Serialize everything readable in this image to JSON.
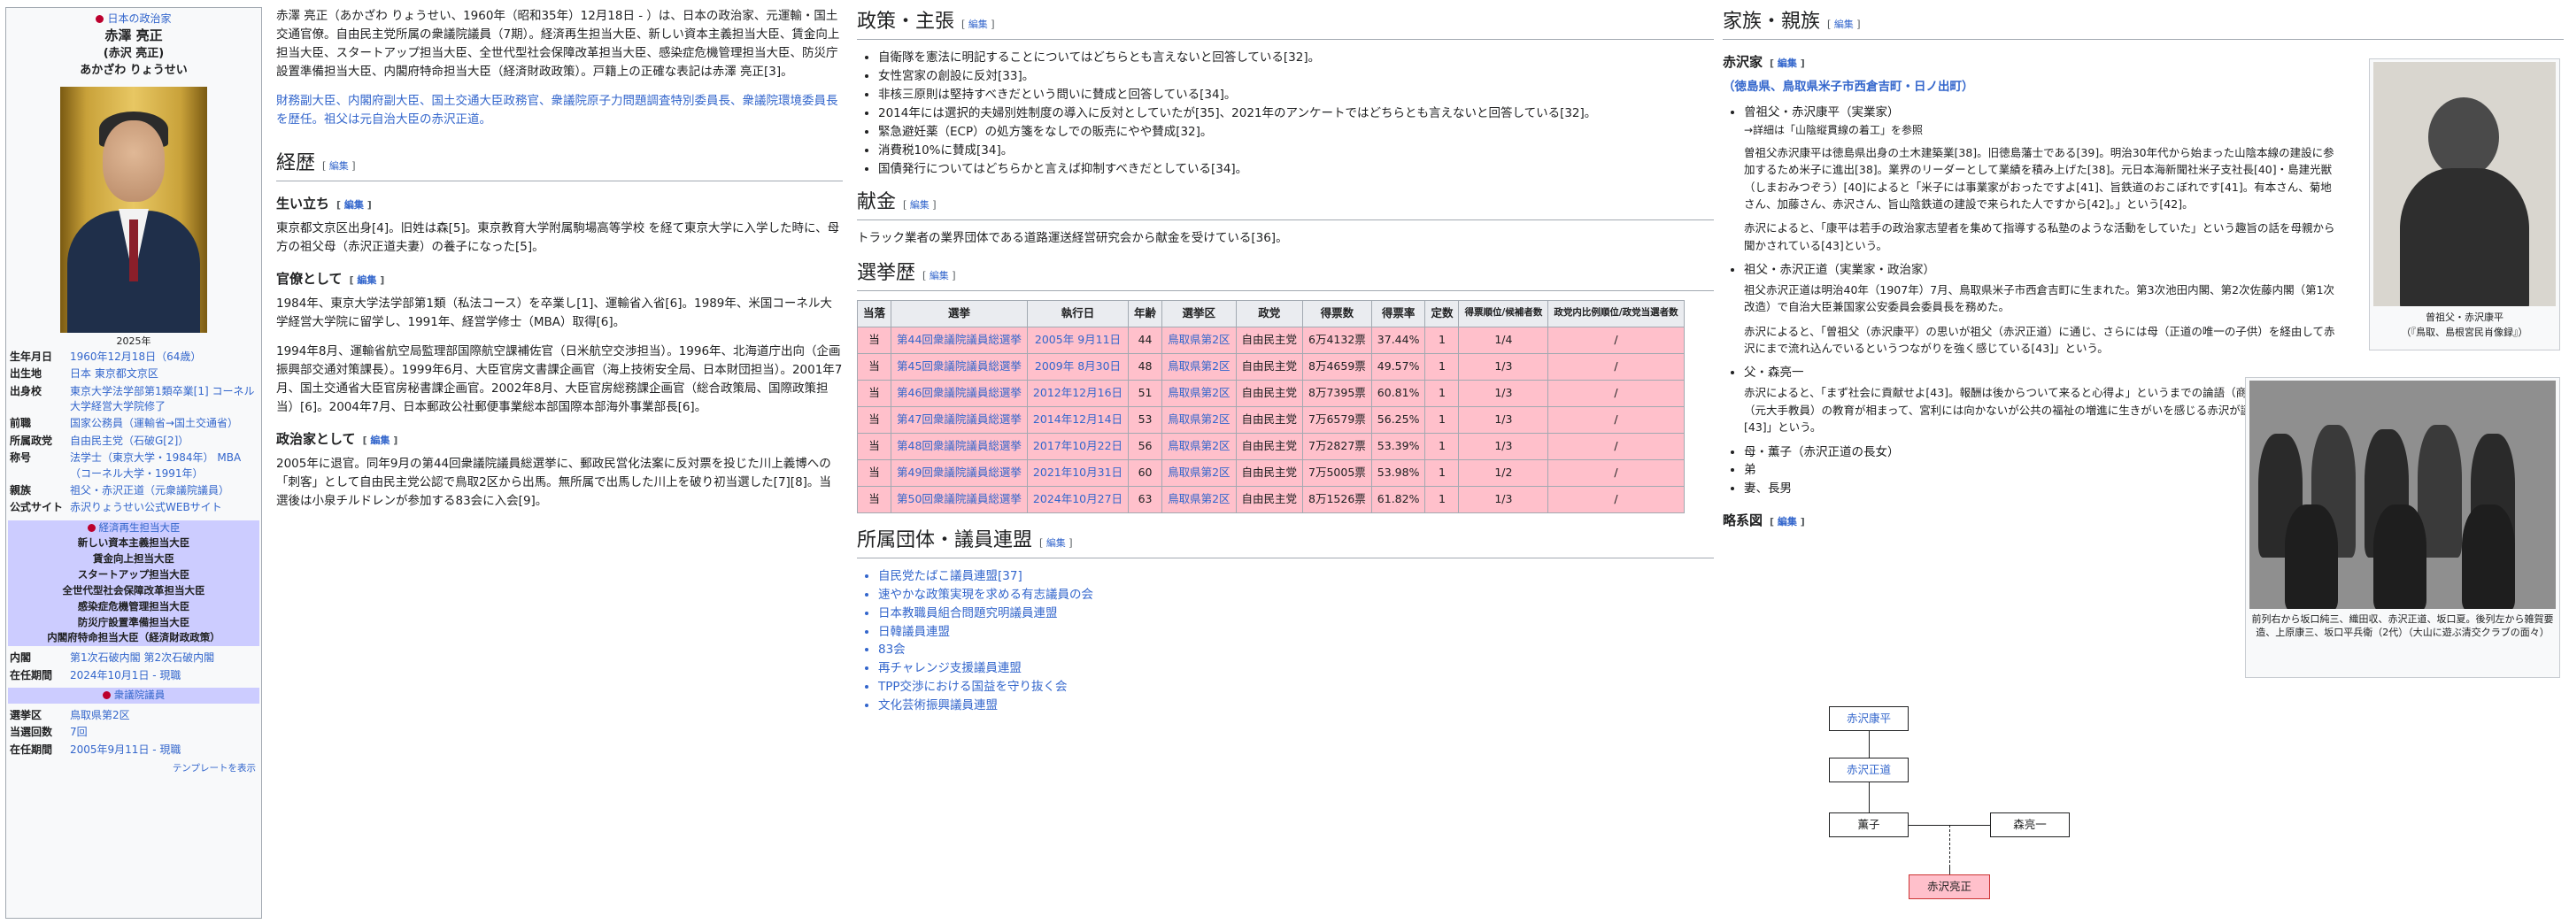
{
  "infobox": {
    "top_label": "日本の政治家",
    "name": "赤澤 亮正",
    "name_old": "(赤沢 亮正)",
    "reading": "あかざわ りょうせい",
    "photo_caption": "2025年",
    "rows": [
      {
        "k": "生年月日",
        "v": "1960年12月18日（64歳）"
      },
      {
        "k": "出生地",
        "v": "日本 東京都文京区"
      },
      {
        "k": "出身校",
        "v": "東京大学法学部第1類卒業[1] コーネル大学経営大学院修了"
      },
      {
        "k": "前職",
        "v": "国家公務員（運輸省→国土交通省）"
      },
      {
        "k": "所属政党",
        "v": "自由民主党（石破G[2]）"
      },
      {
        "k": "称号",
        "v": "法学士（東京大学・1984年） MBA（コーネル大学・1991年）"
      },
      {
        "k": "親族",
        "v": "祖父・赤沢正道（元衆議院議員）"
      },
      {
        "k": "公式サイト",
        "v": "赤沢りょうせい公式WEBサイト"
      }
    ],
    "band1_title": "経済再生担当大臣",
    "band1_lines": [
      "新しい資本主義担当大臣",
      "賃金向上担当大臣",
      "スタートアップ担当大臣",
      "全世代型社会保障改革担当大臣",
      "感染症危機管理担当大臣",
      "防災庁設置準備担当大臣",
      "内閣府特命担当大臣（経済財政政策）"
    ],
    "rows2": [
      {
        "k": "内閣",
        "v": "第1次石破内閣 第2次石破内閣"
      },
      {
        "k": "在任期間",
        "v": "2024年10月1日 - 現職"
      }
    ],
    "band2_title": "衆議院議員",
    "rows3": [
      {
        "k": "選挙区",
        "v": "鳥取県第2区"
      },
      {
        "k": "当選回数",
        "v": "7回"
      },
      {
        "k": "在任期間",
        "v": "2005年9月11日 - 現職"
      }
    ],
    "template_link": "テンプレートを表示"
  },
  "edit_label": "編集",
  "col1": {
    "intro1": "赤澤 亮正（あかざわ りょうせい、1960年（昭和35年）12月18日 - ）は、日本の政治家、元運輸・国土交通官僚。自由民主党所属の衆議院議員（7期）。経済再生担当大臣、新しい資本主義担当大臣、賃金向上担当大臣、スタートアップ担当大臣、全世代型社会保障改革担当大臣、感染症危機管理担当大臣、防災庁設置準備担当大臣、内閣府特命担当大臣（経済財政政策）。戸籍上の正確な表記は赤澤 亮正[3]。",
    "intro2": "財務副大臣、内閣府副大臣、国土交通大臣政務官、衆議院原子力問題調査特別委員長、衆議院環境委員長を歴任。祖父は元自治大臣の赤沢正道。",
    "h_career": "経歴",
    "h_youth": "生い立ち",
    "youth": "東京都文京区出身[4]。旧姓は森[5]。東京教育大学附属駒場高等学校 を経て東京大学に入学した時に、母方の祖父母（赤沢正道夫妻）の養子になった[5]。",
    "h_bureau": "官僚として",
    "bureau1": "1984年、東京大学法学部第1類（私法コース）を卒業し[1]、運輸省入省[6]。1989年、米国コーネル大学経営大学院に留学し、1991年、経営学修士（MBA）取得[6]。",
    "bureau2": "1994年8月、運輸省航空局監理部国際航空課補佐官（日米航空交渉担当）。1996年、北海道庁出向（企画振興部交通対策課長）。1999年6月、大臣官房文書課企画官（海上技術安全局、日本財団担当）。2001年7月、国土交通省大臣官房秘書課企画官。2002年8月、大臣官房総務課企画官（総合政策局、国際政策担当）[6]。2004年7月、日本郵政公社郵便事業総本部国際本部海外事業部長[6]。",
    "h_politician": "政治家として",
    "politician": "2005年に退官。同年9月の第44回衆議院議員総選挙に、郵政民営化法案に反対票を投じた川上義博への「刺客」として自由民主党公認で鳥取2区から出馬。無所属で出馬した川上を破り初当選した[7][8]。当選後は小泉チルドレンが参加する83会に入会[9]。"
  },
  "col2": {
    "h_policy": "政策・主張",
    "policy": [
      "自衛隊を憲法に明記することについてはどちらとも言えないと回答している[32]。",
      "女性宮家の創設に反対[33]。",
      "非核三原則は堅持すべきだという問いに賛成と回答している[34]。",
      "2014年には選択的夫婦別姓制度の導入に反対としていたが[35]、2021年のアンケートではどちらとも言えないと回答している[32]。",
      "緊急避妊薬（ECP）の処方箋をなしでの販売にやや賛成[32]。",
      "消費税10%に賛成[34]。",
      "国債発行についてはどちらかと言えば抑制すべきだとしている[34]。"
    ],
    "h_donation": "献金",
    "donation": "トラック業者の業界団体である道路運送経営研究会から献金を受けている[36]。",
    "h_election": "選挙歴",
    "table_headers": [
      "当落",
      "選挙",
      "執行日",
      "年齢",
      "選挙区",
      "政党",
      "得票数",
      "得票率",
      "定数",
      "得票順位/候補者数",
      "政党内比例順位/政党当選者数"
    ],
    "elections": [
      [
        "当",
        "第44回衆議院議員総選挙",
        "2005年 9月11日",
        "44",
        "鳥取県第2区",
        "自由民主党",
        "6万4132票",
        "37.44%",
        "1",
        "1/4",
        "/"
      ],
      [
        "当",
        "第45回衆議院議員総選挙",
        "2009年 8月30日",
        "48",
        "鳥取県第2区",
        "自由民主党",
        "8万4659票",
        "49.57%",
        "1",
        "1/3",
        "/"
      ],
      [
        "当",
        "第46回衆議院議員総選挙",
        "2012年12月16日",
        "51",
        "鳥取県第2区",
        "自由民主党",
        "8万7395票",
        "60.81%",
        "1",
        "1/3",
        "/"
      ],
      [
        "当",
        "第47回衆議院議員総選挙",
        "2014年12月14日",
        "53",
        "鳥取県第2区",
        "自由民主党",
        "7万6579票",
        "56.25%",
        "1",
        "1/3",
        "/"
      ],
      [
        "当",
        "第48回衆議院議員総選挙",
        "2017年10月22日",
        "56",
        "鳥取県第2区",
        "自由民主党",
        "7万2827票",
        "53.39%",
        "1",
        "1/3",
        "/"
      ],
      [
        "当",
        "第49回衆議院議員総選挙",
        "2021年10月31日",
        "60",
        "鳥取県第2区",
        "自由民主党",
        "7万5005票",
        "53.98%",
        "1",
        "1/2",
        "/"
      ],
      [
        "当",
        "第50回衆議院議員総選挙",
        "2024年10月27日",
        "63",
        "鳥取県第2区",
        "自由民主党",
        "8万1526票",
        "61.82%",
        "1",
        "1/3",
        "/"
      ]
    ],
    "h_groups": "所属団体・議員連盟",
    "groups": [
      "自民党たばこ議員連盟[37]",
      "速やかな政策実現を求める有志議員の会",
      "日本教職員組合問題究明議員連盟",
      "日韓議員連盟",
      "83会",
      "再チャレンジ支援議員連盟",
      "TPP交渉における国益を守り抜く会",
      "文化芸術振興議員連盟"
    ]
  },
  "col3": {
    "h_family": "家族・親族",
    "h_akazawa": "赤沢家",
    "origin": "（徳島県、鳥取県米子市西倉吉町・日ノ出町）",
    "greatgf_title": "曾祖父・赤沢康平（実業家）",
    "greatgf_ref": "→詳細は「山陰縦貫線の着工」を参照",
    "greatgf_p1": "曽祖父赤沢康平は徳島県出身の土木建築業[38]。旧徳島藩士である[39]。明治30年代から始まった山陰本線の建設に参加するため米子に進出[38]。業界のリーダーとして業績を積み上げた[38]。元日本海新聞社米子支社長[40]・島建光獣（しまおみつぞう）[40]によると「米子には事業家がおったですよ[41]、旨鉄道のおこぼれです[41]。有本さん、菊地さん、加藤さん、赤沢さん、旨山陰鉄道の建設で来られた人ですから[42]。」という[42]。",
    "greatgf_p2": "赤沢によると、「康平は若手の政治家志望者を集めて指導する私塾のような活動をしていた」という趣旨の話を母親から聞かされている[43]という。",
    "gf_title": "祖父・赤沢正道（実業家・政治家）",
    "gf_p1": "祖父赤沢正道は明治40年（1907年）7月、鳥取県米子市西倉吉町に生まれた。第3次池田内閣、第2次佐藤内閣（第1次改造）で自治大臣兼国家公安委員会委員長を務めた。",
    "gf_p2": "赤沢によると、「曽祖父（赤沢康平）の思いが祖父（赤沢正道）に通じ、さらには母（正道の唯一の子供）を経由して赤沢にまで流れ込んでいるというつながりを強く感じている[43]」という。",
    "father_title": "父・森亮一",
    "father_p": "赤沢によると、「まず社会に貢献せよ[43]。報酬は後からついて来ると心得よ」というまでの論語（商隊）のような父（元大手教員）の教育が相まって、宮利には向かないが公共の福祉の増進に生きがいを感じる赤沢が誕生した次第です[43]」という。",
    "mother": "母・薫子（赤沢正道の長女）",
    "brother": "弟",
    "wife": "妻、長男",
    "h_tree": "略系図",
    "tree": [
      "赤沢康平",
      "赤沢正道",
      "薫子",
      "森亮一",
      "赤沢亮正"
    ],
    "photo1_caption": "曾祖父・赤沢康平\n（『鳥取、島根宮民肖像録』）",
    "photo2_caption": "前列右から坂口純三、織田収、赤沢正道、坂口夏。後列左から雑賀要造、上原康三、坂口平兵衛（2代）（大山に遊ぶ清交クラブの面々）"
  },
  "colors": {
    "link": "#3366cc",
    "win_row": "#ffc0cb",
    "band": "#ccccff",
    "border": "#a2a9b1"
  }
}
